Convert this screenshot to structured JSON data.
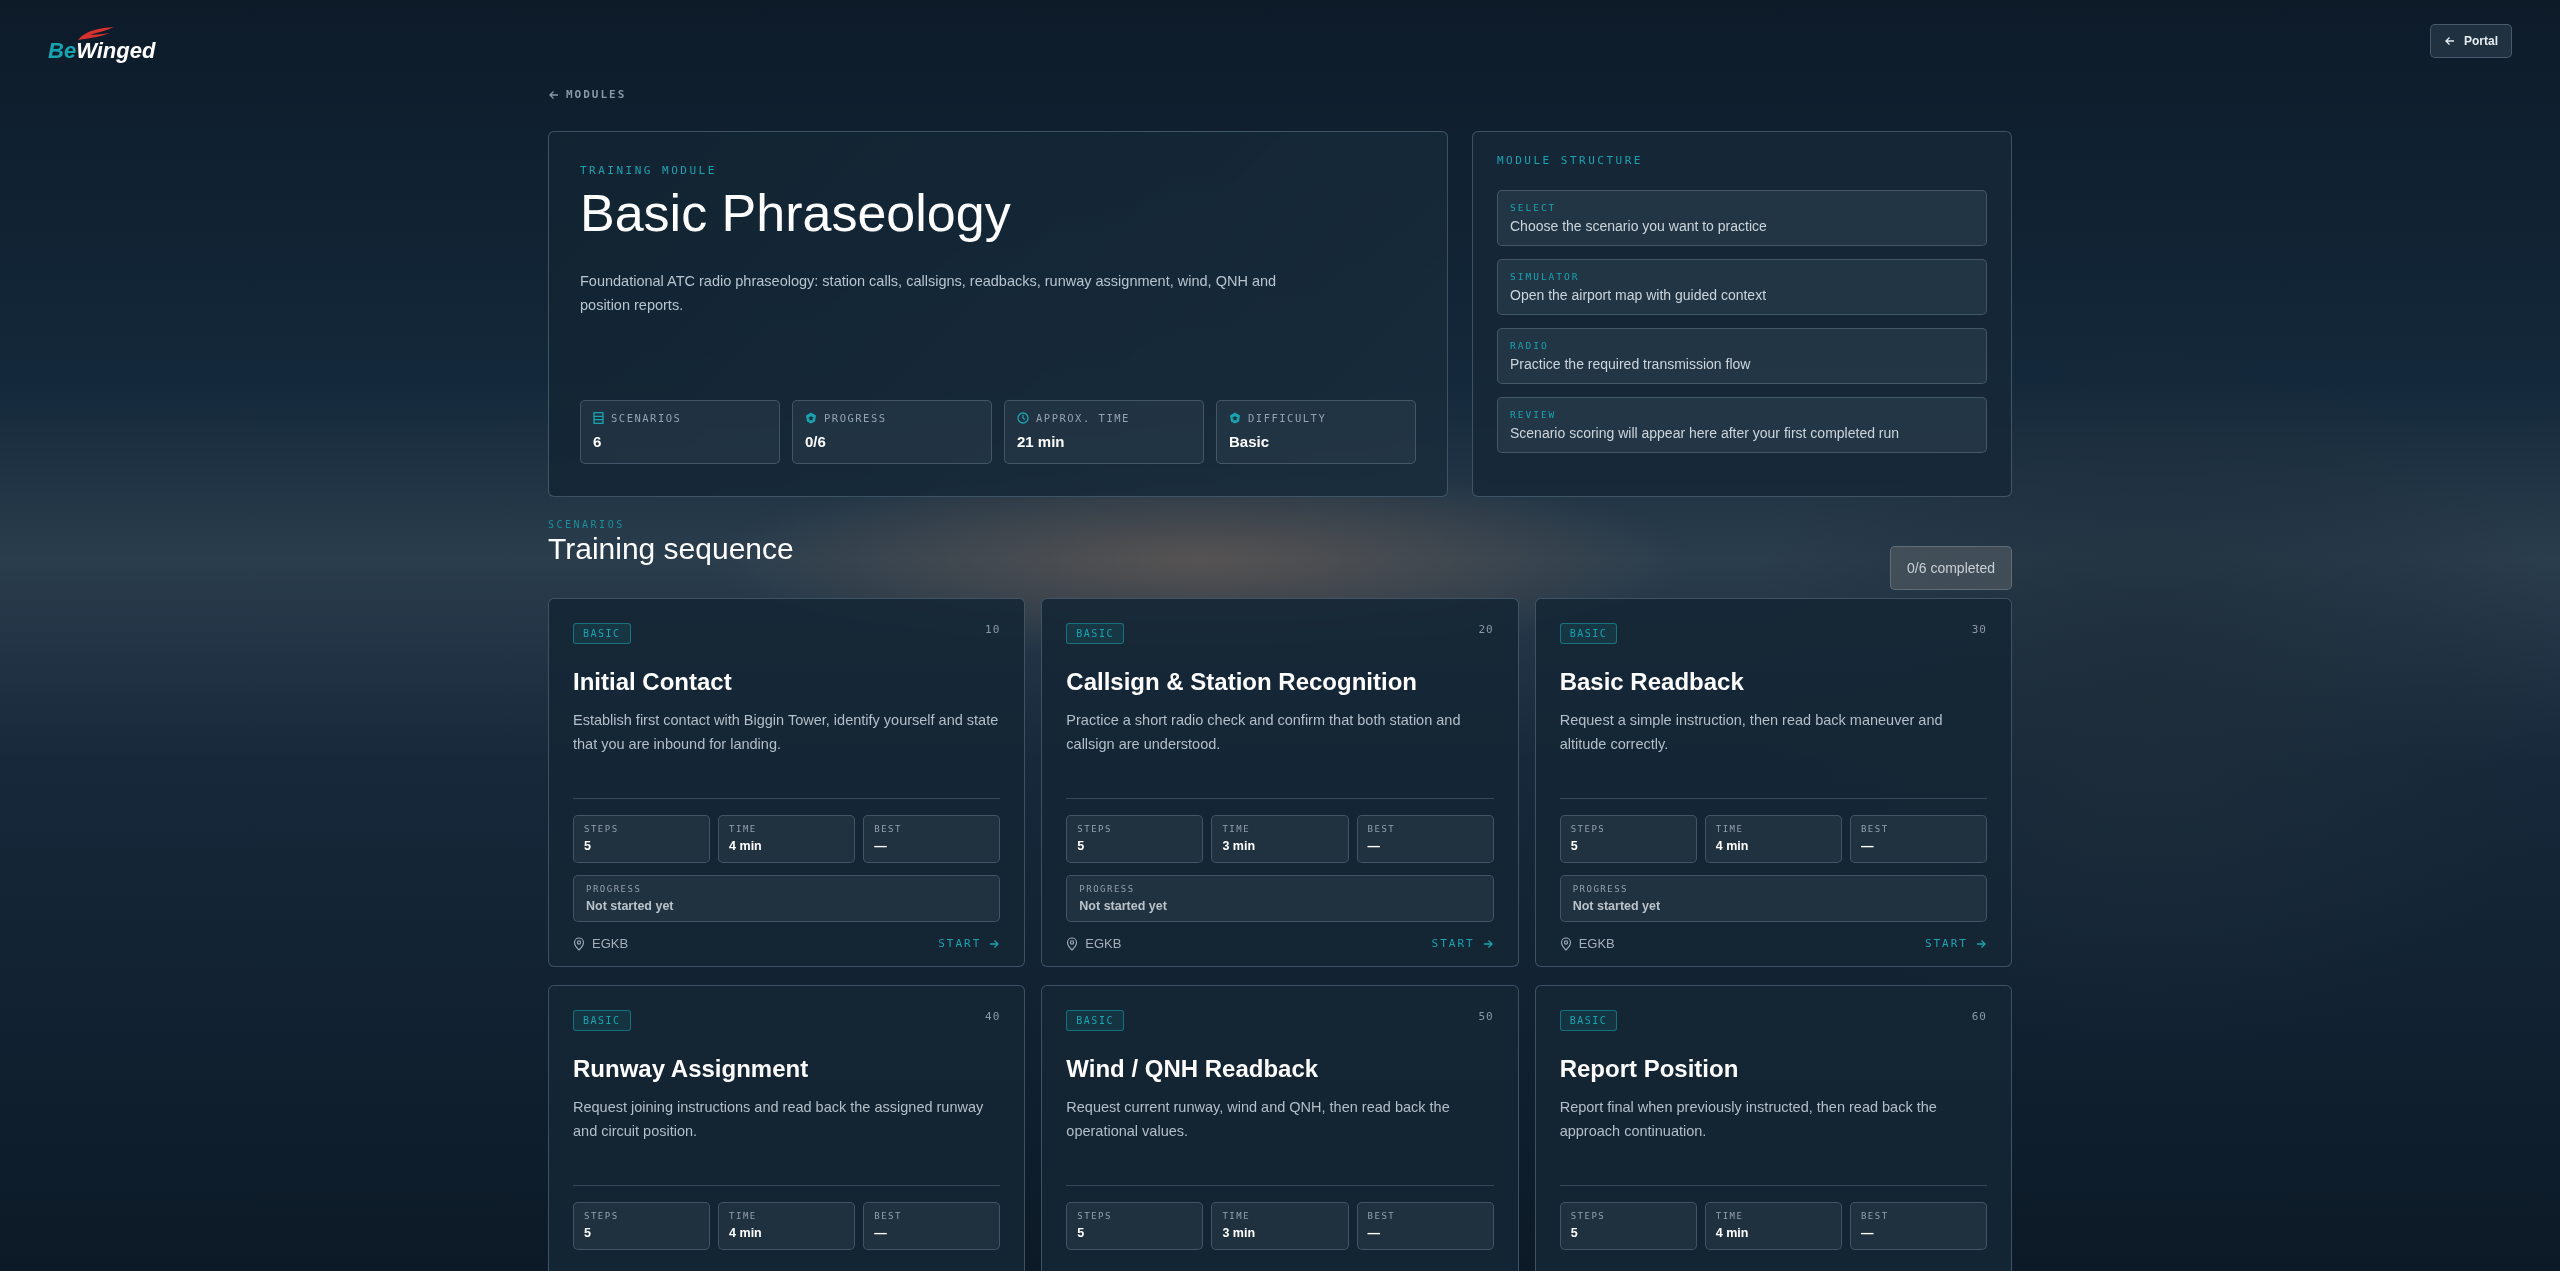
{
  "header": {
    "logo": {
      "part_1": "Be",
      "part_2": "Winged"
    },
    "portal_button": "Portal"
  },
  "back_link": "MODULES",
  "hero": {
    "eyebrow": "TRAINING MODULE",
    "title": "Basic Phraseology",
    "description": "Foundational ATC radio phraseology: station calls, callsigns, readbacks, runway assignment, wind, QNH and position reports.",
    "stats": [
      {
        "kind": "list",
        "label": "SCENARIOS",
        "value": "6"
      },
      {
        "kind": "badge",
        "label": "PROGRESS",
        "value": "0/6"
      },
      {
        "kind": "clock",
        "label": "APPROX. TIME",
        "value": "21 min"
      },
      {
        "kind": "badge",
        "label": "DIFFICULTY",
        "value": "Basic"
      }
    ]
  },
  "structure": {
    "title": "MODULE STRUCTURE",
    "steps": [
      {
        "label": "SELECT",
        "text": "Choose the scenario you want to practice"
      },
      {
        "label": "SIMULATOR",
        "text": "Open the airport map with guided context"
      },
      {
        "label": "RADIO",
        "text": "Practice the required transmission flow"
      },
      {
        "label": "REVIEW",
        "text": "Scenario scoring will appear here after your first completed run"
      }
    ]
  },
  "scenarios": {
    "eyebrow": "SCENARIOS",
    "title": "Training sequence",
    "completed": "0/6 completed",
    "cards": [
      {
        "tag": "BASIC",
        "number": "10",
        "title": "Initial Contact",
        "description": "Establish first contact with Biggin Tower, identify yourself and state that you are inbound for landing.",
        "stats": [
          {
            "label": "STEPS",
            "value": "5"
          },
          {
            "label": "TIME",
            "value": "4 min"
          },
          {
            "label": "BEST",
            "value": "—"
          }
        ],
        "progress": {
          "label": "PROGRESS",
          "value": "Not started yet"
        },
        "location": "EGKB",
        "action": "START"
      },
      {
        "tag": "BASIC",
        "number": "20",
        "title": "Callsign & Station Recognition",
        "description": "Practice a short radio check and confirm that both station and callsign are understood.",
        "stats": [
          {
            "label": "STEPS",
            "value": "5"
          },
          {
            "label": "TIME",
            "value": "3 min"
          },
          {
            "label": "BEST",
            "value": "—"
          }
        ],
        "progress": {
          "label": "PROGRESS",
          "value": "Not started yet"
        },
        "location": "EGKB",
        "action": "START"
      },
      {
        "tag": "BASIC",
        "number": "30",
        "title": "Basic Readback",
        "description": "Request a simple instruction, then read back maneuver and altitude correctly.",
        "stats": [
          {
            "label": "STEPS",
            "value": "5"
          },
          {
            "label": "TIME",
            "value": "4 min"
          },
          {
            "label": "BEST",
            "value": "—"
          }
        ],
        "progress": {
          "label": "PROGRESS",
          "value": "Not started yet"
        },
        "location": "EGKB",
        "action": "START"
      },
      {
        "tag": "BASIC",
        "number": "40",
        "title": "Runway Assignment",
        "description": "Request joining instructions and read back the assigned runway and circuit position.",
        "stats": [
          {
            "label": "STEPS",
            "value": "5"
          },
          {
            "label": "TIME",
            "value": "4 min"
          },
          {
            "label": "BEST",
            "value": "—"
          }
        ]
      },
      {
        "tag": "BASIC",
        "number": "50",
        "title": "Wind / QNH Readback",
        "description": "Request current runway, wind and QNH, then read back the operational values.",
        "stats": [
          {
            "label": "STEPS",
            "value": "5"
          },
          {
            "label": "TIME",
            "value": "3 min"
          },
          {
            "label": "BEST",
            "value": "—"
          }
        ]
      },
      {
        "tag": "BASIC",
        "number": "60",
        "title": "Report Position",
        "description": "Report final when previously instructed, then read back the approach continuation.",
        "stats": [
          {
            "label": "STEPS",
            "value": "5"
          },
          {
            "label": "TIME",
            "value": "4 min"
          },
          {
            "label": "BEST",
            "value": "—"
          }
        ]
      }
    ]
  }
}
